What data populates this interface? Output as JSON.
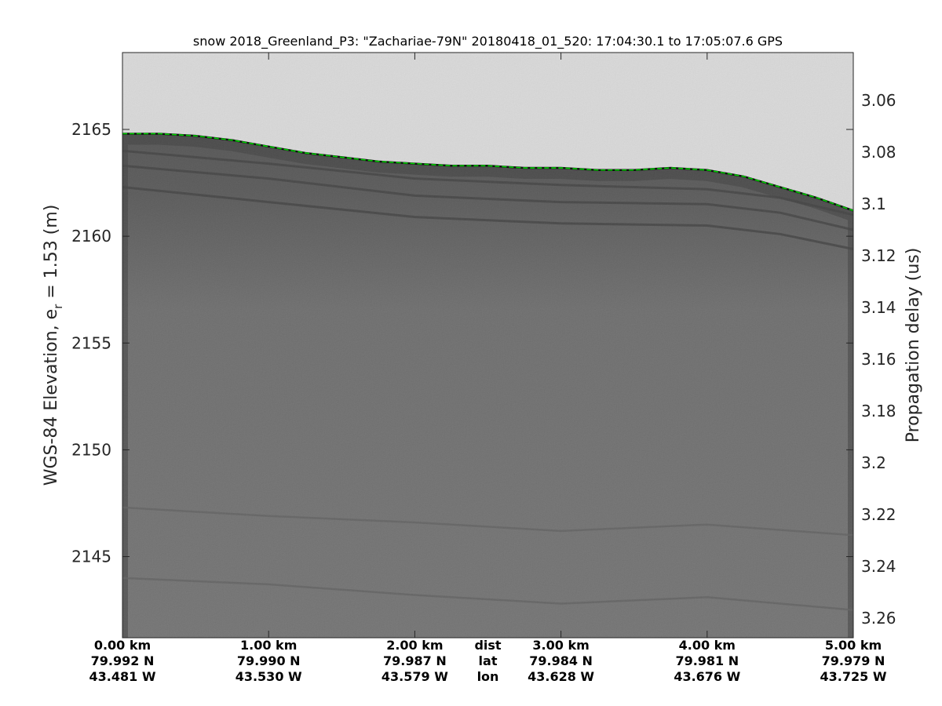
{
  "chart_data": {
    "type": "heatmap",
    "title": "snow 2018_Greenland_P3: \"Zachariae-79N\"  20180418_01_520: 17:04:30.1 to 17:05:07.6 GPS",
    "ylabel_left_prefix": "WGS-84 Elevation, e",
    "ylabel_left_sub": "r",
    "ylabel_left_suffix": " = 1.53 (m)",
    "ylabel_right": "Propagation delay (us)",
    "xlim": [
      0,
      5
    ],
    "ylim_left": [
      2141.2,
      2168.6
    ],
    "ylim_right": [
      3.0415,
      3.2675
    ],
    "grid": false,
    "colormap": "gray",
    "left_ticks": [
      2145,
      2150,
      2155,
      2160,
      2165
    ],
    "left_tick_labels": [
      "2145",
      "2150",
      "2155",
      "2160",
      "2165"
    ],
    "right_ticks": [
      3.06,
      3.08,
      3.1,
      3.12,
      3.14,
      3.16,
      3.18,
      3.2,
      3.22,
      3.24,
      3.26
    ],
    "right_tick_labels": [
      "3.06",
      "3.08",
      "3.1",
      "3.12",
      "3.14",
      "3.16",
      "3.18",
      "3.2",
      "3.22",
      "3.24",
      "3.26"
    ],
    "bottom_row_labels": [
      "dist",
      "lat",
      "lon"
    ],
    "bottom_ticks": [
      {
        "x": 0,
        "dist": "0.00 km",
        "lat": "79.992 N",
        "lon": "43.481 W"
      },
      {
        "x": 1,
        "dist": "1.00 km",
        "lat": "79.990 N",
        "lon": "43.530 W"
      },
      {
        "x": 2,
        "dist": "2.00 km",
        "lat": "79.987 N",
        "lon": "43.579 W"
      },
      {
        "x": 3,
        "dist": "3.00 km",
        "lat": "79.984 N",
        "lon": "43.628 W"
      },
      {
        "x": 4,
        "dist": "4.00 km",
        "lat": "79.981 N",
        "lon": "43.676 W"
      },
      {
        "x": 5,
        "dist": "5.00 km",
        "lat": "79.979 N",
        "lon": "43.725 W"
      }
    ],
    "surface": {
      "x": [
        0,
        0.25,
        0.5,
        0.75,
        1,
        1.25,
        1.5,
        1.75,
        2,
        2.25,
        2.5,
        2.75,
        3,
        3.25,
        3.5,
        3.75,
        4,
        4.25,
        4.5,
        4.75,
        5
      ],
      "y": [
        2164.8,
        2164.8,
        2164.7,
        2164.5,
        2164.2,
        2163.9,
        2163.7,
        2163.5,
        2163.4,
        2163.3,
        2163.3,
        2163.2,
        2163.2,
        2163.1,
        2163.1,
        2163.2,
        2163.1,
        2162.8,
        2162.3,
        2161.8,
        2161.2
      ],
      "color": "#00d000"
    },
    "layers": [
      {
        "x": [
          0,
          1,
          2,
          3,
          4,
          4.5,
          5
        ],
        "y": [
          2162.3,
          2161.6,
          2160.9,
          2160.6,
          2160.5,
          2160.1,
          2159.4
        ]
      },
      {
        "x": [
          0,
          1,
          2,
          3,
          4,
          4.5,
          5
        ],
        "y": [
          2163.3,
          2162.7,
          2161.9,
          2161.6,
          2161.5,
          2161.1,
          2160.3
        ]
      },
      {
        "x": [
          0,
          1,
          2,
          3,
          4,
          4.5,
          5
        ],
        "y": [
          2164.0,
          2163.4,
          2162.7,
          2162.4,
          2162.2,
          2161.8,
          2161.0
        ]
      },
      {
        "x": [
          0,
          1,
          2,
          3,
          4,
          5
        ],
        "y": [
          2147.3,
          2146.9,
          2146.6,
          2146.2,
          2146.5,
          2146.0
        ]
      },
      {
        "x": [
          0,
          1,
          2,
          3,
          4,
          5
        ],
        "y": [
          2144.0,
          2143.7,
          2143.2,
          2142.8,
          2143.1,
          2142.5
        ]
      }
    ],
    "colors": {
      "air": "#d9d9d9",
      "firn": "#6f6f6f",
      "deep": "#6a6a6a",
      "surface_line": "#00d000"
    }
  }
}
